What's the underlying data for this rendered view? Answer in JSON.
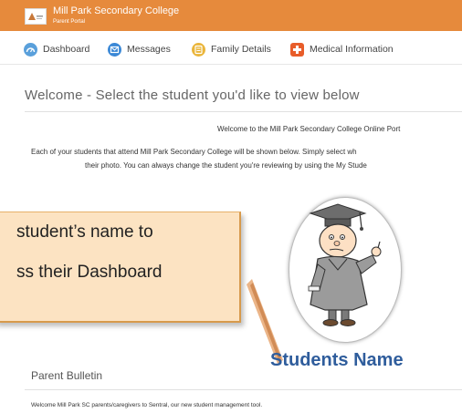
{
  "header": {
    "title": "Mill Park Secondary College",
    "subtitle": "Parent Portal",
    "background_color": "#e68a3c"
  },
  "nav": {
    "items": [
      {
        "label": "Dashboard",
        "icon": "dashboard-icon",
        "color": "#5aa0db"
      },
      {
        "label": "Messages",
        "icon": "mail-icon",
        "color": "#3b88d6"
      },
      {
        "label": "Family Details",
        "icon": "family-icon",
        "color": "#eab53a"
      },
      {
        "label": "Medical Information",
        "icon": "medical-icon",
        "color": "#e85d2a"
      }
    ]
  },
  "main": {
    "title": "Welcome - Select the student you'd like to view below",
    "welcome_line": "Welcome to the Mill Park Secondary College Online Port",
    "info_line_1": "Each of your students that attend Mill Park Secondary College will be shown below. Simply select wh",
    "info_line_2": "their photo. You can always change the student you're reviewing by using the My Stude"
  },
  "callout": {
    "line_1": "student’s name to",
    "line_2": "ss their Dashboard"
  },
  "student": {
    "name": "Students Name",
    "name_color": "#2f5d9c",
    "photo_icon": "student-cartoon"
  },
  "bulletin": {
    "title": "Parent Bulletin",
    "text": "Welcome Mill Park SC parents/caregivers to Sentral, our new student management tool."
  }
}
